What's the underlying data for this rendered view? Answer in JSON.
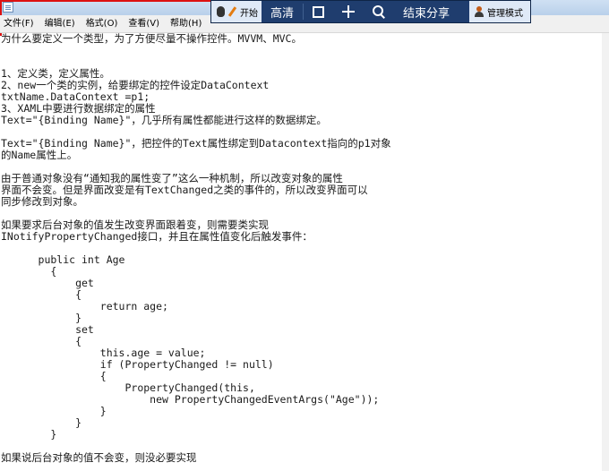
{
  "menu": {
    "items": [
      {
        "name": "menu-file",
        "label": "文件(F)"
      },
      {
        "name": "menu-edit",
        "label": "编辑(E)"
      },
      {
        "name": "menu-format",
        "label": "格式(O)"
      },
      {
        "name": "menu-view",
        "label": "查看(V)"
      },
      {
        "name": "menu-help",
        "label": "帮助(H)"
      }
    ]
  },
  "share_toolbar": {
    "start_label": "开始",
    "hd_label": "高清",
    "end_share_label": "结束分享",
    "admin_label": "管理模式",
    "accent_color": "#1f3d6e"
  },
  "document": {
    "lines": [
      "为什么要定义一个类型，为了方便尽量不操作控件。MVVM、MVC。",
      "",
      "",
      "1、定义类，定义属性。",
      "2、new一个类的实例，给要绑定的控件设定DataContext",
      "txtName.DataContext =p1;",
      "3、XAML中要进行数据绑定的属性",
      "Text=\"{Binding Name}\"，几乎所有属性都能进行这样的数据绑定。",
      "",
      "Text=\"{Binding Name}\"，把控件的Text属性绑定到Datacontext指向的p1对象",
      "的Name属性上。",
      "",
      "由于普通对象没有“通知我的属性变了”这么一种机制，所以改变对象的属性",
      "界面不会变。但是界面改变是有TextChanged之类的事件的，所以改变界面可以",
      "同步修改到对象。",
      "",
      "如果要求后台对象的值发生改变界面跟着变，则需要类实现",
      "INotifyPropertyChanged接口，并且在属性值变化后触发事件：",
      "",
      "      public int Age",
      "        {",
      "            get",
      "            {",
      "                return age;",
      "            }",
      "            set",
      "            {",
      "                this.age = value;",
      "                if (PropertyChanged != null)",
      "                {",
      "                    PropertyChanged(this,",
      "                        new PropertyChangedEventArgs(\"Age\"));",
      "                }",
      "            }",
      "        }",
      "",
      "如果说后台对象的值不会变，则没必要实现"
    ]
  }
}
